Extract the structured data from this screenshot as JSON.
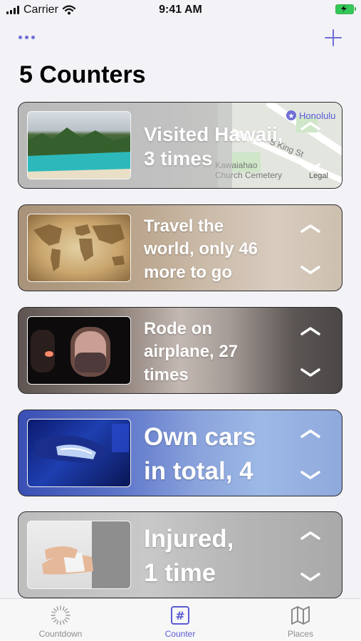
{
  "status_bar": {
    "carrier": "Carrier",
    "time": "9:41 AM"
  },
  "nav": {
    "more_icon": "ellipsis-icon",
    "add_icon": "plus-icon"
  },
  "title": "5 Counters",
  "counters": [
    {
      "label": "Visited Hawaii, 3 times",
      "line1": "Visited Hawaii,",
      "line2": "3 times",
      "image": "hawaii-coast-photo",
      "map": {
        "place": "Honolulu",
        "street": "S King St",
        "cemetery_line1": "Kawaiahao",
        "cemetery_line2": "Church Cemetery",
        "legal": "Legal"
      }
    },
    {
      "label": "Travel the world, only 46 more to go",
      "line1": "Travel the",
      "line2": "world, only 46",
      "line3": "more to go",
      "image": "world-map-photo"
    },
    {
      "label": "Rode on airplane, 27 times",
      "line1": "Rode on",
      "line2": "airplane, 27",
      "line3": "times",
      "image": "airplane-window-photo"
    },
    {
      "label": "Own cars in total, 4",
      "line1": "Own cars",
      "line2": "in total, 4",
      "image": "car-headlight-photo"
    },
    {
      "label": "Injured, 1 time",
      "line1": "Injured,",
      "line2": "1 time",
      "image": "bandaged-wrist-photo"
    }
  ],
  "tabs": [
    {
      "label": "Countdown",
      "icon": "countdown-icon",
      "active": false
    },
    {
      "label": "Counter",
      "icon": "hash-icon",
      "active": true
    },
    {
      "label": "Places",
      "icon": "map-icon",
      "active": false
    }
  ],
  "colors": {
    "accent": "#5b5bd6",
    "tab_inactive": "#8e8e93",
    "battery": "#34c759"
  }
}
